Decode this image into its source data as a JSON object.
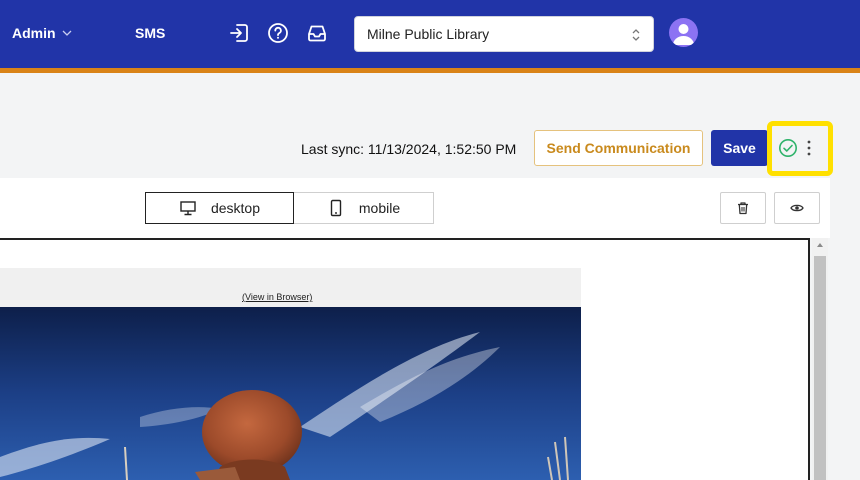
{
  "nav": {
    "admin_label": "Admin",
    "sms_label": "SMS",
    "library_select_value": "Milne Public Library",
    "icons": [
      "logout-icon",
      "help-icon",
      "inbox-icon",
      "user-avatar-icon"
    ]
  },
  "actions": {
    "last_sync": "Last sync: 11/13/2024, 1:52:50 PM",
    "send_label": "Send Communication",
    "save_label": "Save"
  },
  "editor": {
    "desktop_label": "desktop",
    "mobile_label": "mobile"
  },
  "preview": {
    "view_in_browser": "(View in Browser)"
  },
  "colors": {
    "brand_blue": "#2134a8",
    "accent_orange": "#d98317",
    "send_text": "#c98a1d",
    "status_green": "#2fb36b",
    "highlight_yellow": "#ffe000"
  }
}
